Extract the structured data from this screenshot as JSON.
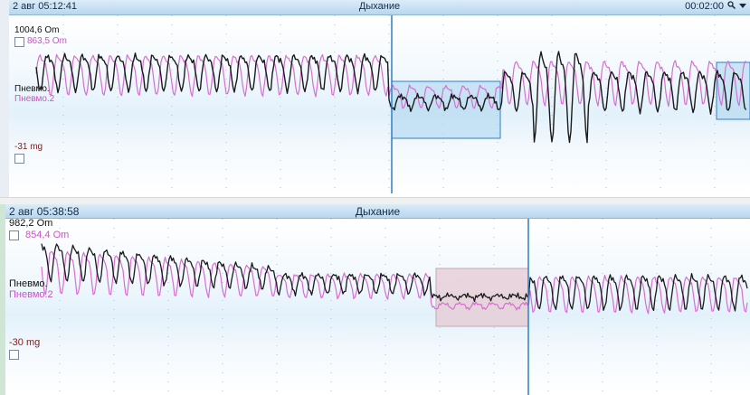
{
  "top": {
    "title_left": "2 авг 05:12:41",
    "title_center": "Дыхание",
    "title_right": "00:02:00",
    "scale_top": "1004,6 Om",
    "scale_top2": "863,5 Om",
    "channel1": "Пневмо.",
    "channel2": "Пневмо.2",
    "scale_bottom": "-31 mg"
  },
  "bottom": {
    "title_left": "2 авг 05:38:58",
    "title_center": "Дыхание",
    "scale_top": "982,2 Om",
    "scale_top2": "854,4 Om",
    "channel1": "Пневмо.",
    "channel2": "Пневмо.2",
    "scale_bottom": "-30 mg"
  },
  "icons": {
    "zoom": "magnifier-icon",
    "menu": "dropdown-arrow-icon"
  },
  "colors": {
    "trace1": "#1a1a1a",
    "trace2": "#d66fd0",
    "cursor": "#2f7fc6",
    "selection_top": "#a9d3ee",
    "selection_bottom": "#e6c9d3",
    "scale_text2": "#c955c2",
    "scale_mg": "#7a1e1e"
  }
}
